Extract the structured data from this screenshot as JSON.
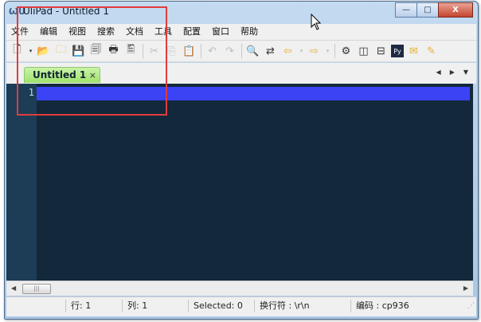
{
  "window": {
    "title": "UliPad - Untitled 1",
    "app_icon": "ulipad-icon",
    "controls": {
      "minimize": "—",
      "maximize": "□",
      "close": "X"
    }
  },
  "menu": [
    "文件",
    "编辑",
    "视图",
    "搜索",
    "文档",
    "工具",
    "配置",
    "窗口",
    "帮助"
  ],
  "toolbar": [
    {
      "name": "new-file-icon",
      "glyph": "🗋"
    },
    {
      "name": "new-dropdown-icon",
      "glyph": "▾"
    },
    {
      "name": "open-folder-icon",
      "glyph": "📂"
    },
    {
      "name": "open-recent-icon",
      "glyph": "🗀"
    },
    {
      "name": "save-icon",
      "glyph": "💾"
    },
    {
      "name": "save-all-icon",
      "glyph": "🗐"
    },
    {
      "name": "print-icon",
      "glyph": "🖶"
    },
    {
      "name": "print-preview-icon",
      "glyph": "🖺"
    },
    {
      "name": "cut-icon",
      "glyph": "✂"
    },
    {
      "name": "copy-icon",
      "glyph": "⎘"
    },
    {
      "name": "paste-icon",
      "glyph": "📋"
    },
    {
      "name": "undo-icon",
      "glyph": "↶"
    },
    {
      "name": "redo-icon",
      "glyph": "↷"
    },
    {
      "name": "find-icon",
      "glyph": "🔍"
    },
    {
      "name": "replace-icon",
      "glyph": "⇄"
    },
    {
      "name": "back-icon",
      "glyph": "⇦"
    },
    {
      "name": "back-dropdown-icon",
      "glyph": "▾"
    },
    {
      "name": "forward-icon",
      "glyph": "⇨"
    },
    {
      "name": "forward-dropdown-icon",
      "glyph": "▾"
    },
    {
      "name": "preferences-icon",
      "glyph": "⚙"
    },
    {
      "name": "split-vertical-icon",
      "glyph": "◫"
    },
    {
      "name": "split-horizontal-icon",
      "glyph": "⊟"
    },
    {
      "name": "python-shell-icon",
      "glyph": "Py"
    },
    {
      "name": "message-icon",
      "glyph": "✉"
    },
    {
      "name": "edit-tag-icon",
      "glyph": "✎"
    }
  ],
  "tabs": [
    {
      "label": "Untitled 1",
      "close": "×"
    }
  ],
  "tab_nav": {
    "prev": "◀",
    "next": "▶",
    "menu": "▼"
  },
  "editor": {
    "line_numbers": [
      "1"
    ],
    "current_line_color": "#3c43f5",
    "background": "#13293b"
  },
  "scrollbar": {
    "left": "◀",
    "right": "▶",
    "thumb": "|||"
  },
  "status": {
    "row": "行: 1",
    "col": "列: 1",
    "selected": "Selected: 0",
    "eol": "换行符 : \\r\\n",
    "encoding": "编码 : cp936"
  },
  "annotation": {
    "color": "#e23b3b"
  }
}
